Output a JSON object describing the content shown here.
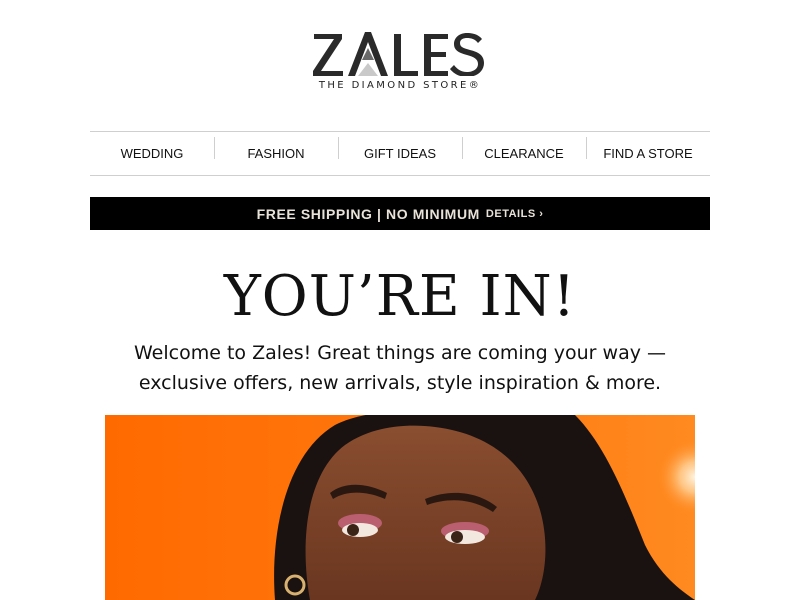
{
  "brand": {
    "name": "ZALES",
    "tagline": "THE DIAMOND STORE®"
  },
  "nav": {
    "items": [
      {
        "label": "WEDDING"
      },
      {
        "label": "FASHION"
      },
      {
        "label": "GIFT IDEAS"
      },
      {
        "label": "CLEARANCE"
      },
      {
        "label": "FIND A STORE"
      }
    ]
  },
  "promo": {
    "text": "FREE SHIPPING | NO MINIMUM",
    "details": "DETAILS ›"
  },
  "hero": {
    "headline": "YOU’RE IN!",
    "message_line1": "Welcome to Zales! Great things are coming your way —",
    "message_line2": "exclusive offers, new arrivals, style inspiration & more."
  },
  "colors": {
    "hero_background": "#ff6a00",
    "promo_background": "#000000",
    "skin": "#7a4228",
    "hair": "#1a1210"
  }
}
